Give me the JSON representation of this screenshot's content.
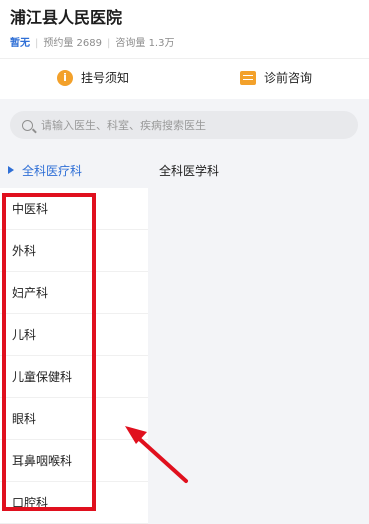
{
  "hospital": {
    "name": "浦江县人民医院",
    "level": "暂无",
    "appointments": "预约量 2689",
    "consultations": "咨询量 1.3万"
  },
  "actions": {
    "notice_label": "挂号须知",
    "notice_icon": "info-icon",
    "consult_label": "诊前咨询",
    "consult_icon": "chat-icon"
  },
  "search": {
    "placeholder": "请输入医生、科室、疾病搜索医生"
  },
  "departments": {
    "selected": "全科医疗科",
    "list": [
      "中医科",
      "外科",
      "妇产科",
      "儿科",
      "儿童保健科",
      "眼科",
      "耳鼻咽喉科",
      "口腔科"
    ],
    "sub": [
      "全科医学科"
    ]
  },
  "colors": {
    "accent": "#2f6fd6",
    "icon_orange": "#f3a12b",
    "highlight_red": "#e0101e"
  }
}
